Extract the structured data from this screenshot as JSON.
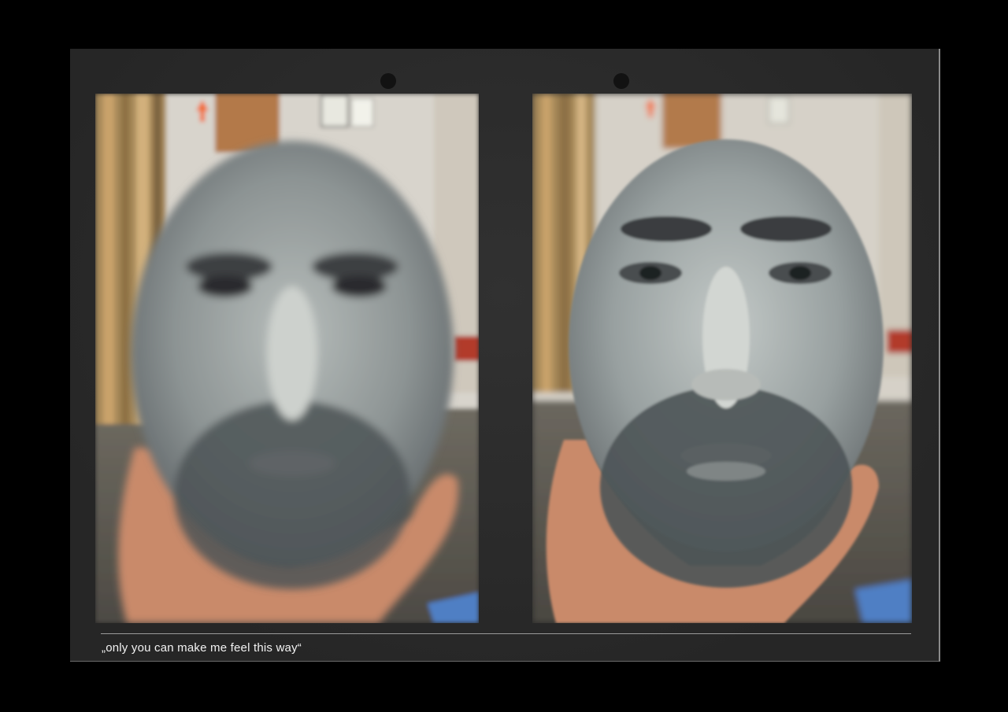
{
  "caption": "„only you can make me feel this way“",
  "photos": [
    {
      "subject": "blurred-face-mask-photo",
      "focus": "blurred"
    },
    {
      "subject": "sharp-face-mask-photo",
      "focus": "sharp"
    }
  ],
  "colors": {
    "background": "#000000",
    "sheet": "#2b2b2b",
    "caption_text": "#f2f2f2",
    "mask_gray": "#8e9698",
    "skin": "#c98a6a"
  }
}
